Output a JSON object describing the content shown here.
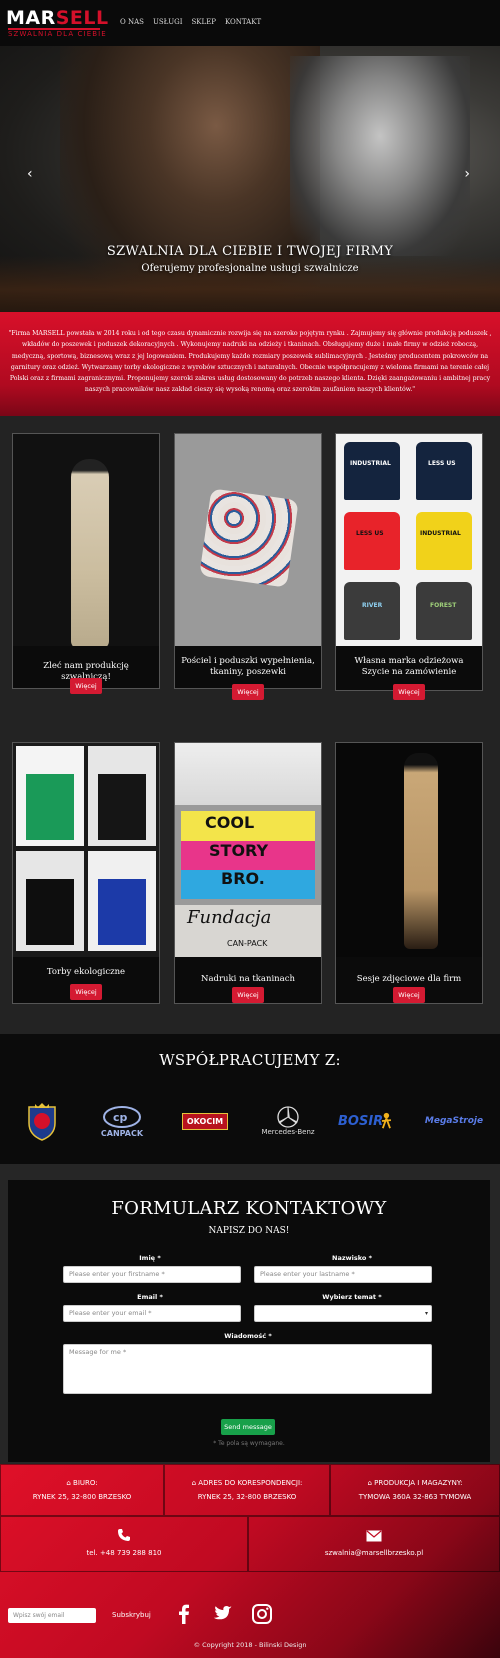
{
  "nav": {
    "logo_main_a": "MAR",
    "logo_main_b": "SELL",
    "logo_sub": "SZWALNIA DLA CIEBIE",
    "menu": [
      "O NAS",
      "USŁUGI",
      "SKLEP",
      "KONTAKT"
    ]
  },
  "hero": {
    "title": "SZWALNIA DLA CIEBIE I TWOJEJ FIRMY",
    "subtitle": "Oferujemy profesjonalne usługi szwalnicze",
    "prev": "‹",
    "next": "›"
  },
  "intro": {
    "text": "\"Firma MARSELL powstała w 2014 roku i od tego czasu dynamicznie rozwija się na szeroko pojętym rynku . Zajmujemy się głównie produkcją poduszek , wkładów do poszewek i poduszek dekoracyjnych . Wykonujemy nadruki na odzieży i tkaninach. Obsługujemy duże i małe firmy w odzież roboczą, medyczną, sportową, biznesową wraz z jej logowaniem. Produkujemy każde rozmiary poszewek sublimacyjnych . Jesteśmy producentem pokrowców na garnitury oraz odzież. Wytwarzamy torby ekologiczne z wyrobów sztucznych i naturalnych. Obecnie współpracujemy z wieloma firmami na terenie całej Polski oraz z firmami zagranicznymi. Proponujemy szeroki zakres usług dostosowany do potrzeb naszego klienta. Dzięki zaangażowaniu i ambitnej pracy naszych pracowników nasz zakład cieszy się wysoką renomą oraz szerokim zaufaniem naszych klientów.\""
  },
  "products": {
    "more_label": "Więcej",
    "items": [
      {
        "title": "Zleć nam produkcję szwalniczą!"
      },
      {
        "title": "Pościel i poduszki wypełnienia, tkaniny, poszewki"
      },
      {
        "title": "Własna marka odzieżowa Szycie na zamówienie"
      },
      {
        "title": "Torby ekologiczne"
      },
      {
        "title": "Nadruki na tkaninach"
      },
      {
        "title": "Sesje zdjęciowe dla firm"
      }
    ],
    "shirt_prints": [
      "INDUSTRIAL",
      "LESS US",
      "LESS US",
      "INDUSTRIAL",
      "RIVER",
      "FOREST"
    ],
    "print_texts": [
      "COOL",
      "STORY",
      "BRO.",
      "Fundacja",
      "CAN-PACK"
    ]
  },
  "partners": {
    "title": "WSPÓŁPRACUJEMY Z:",
    "logos": [
      "CANPACK",
      "OKOCIM",
      "Mercedes-Benz",
      "BOSIR",
      "MegaStroje"
    ]
  },
  "form": {
    "title": "FORMULARZ KONTAKTOWY",
    "subtitle": "NAPISZ DO NAS!",
    "firstname_label": "Imię *",
    "firstname_placeholder": "Please enter your firstname *",
    "lastname_label": "Nazwisko *",
    "lastname_placeholder": "Please enter your lastname *",
    "email_label": "Email *",
    "email_placeholder": "Please enter your email *",
    "topic_label": "Wybierz temat *",
    "message_label": "Wiadomość *",
    "message_placeholder": "Message for me *",
    "send_label": "Send message",
    "required_note": "* Te pola są wymagane."
  },
  "contact": {
    "office_label": "BIURO:",
    "office_value": "RYNEK 25, 32-800 BRZESKO",
    "mail_label": "ADRES DO KORESPONDENCJI:",
    "mail_value": "RYNEK 25, 32-800 BRZESKO",
    "prod_label": "PRODUKCJA I MAGAZYNY:",
    "prod_value": "TYMOWA 360A 32-863 TYMOWA",
    "phone": "tel. +48 739 288 810",
    "email": "szwalnia@marsellbrzesko.pl",
    "newsletter_placeholder": "Wpisz swój email",
    "subscribe_label": "Subskrybuj",
    "copyright": "© Copyright 2018 - Bilinski Design"
  },
  "colors": {
    "accent_red": "#d4102a",
    "button_red": "#d41a32",
    "send_green": "#18a04a"
  }
}
